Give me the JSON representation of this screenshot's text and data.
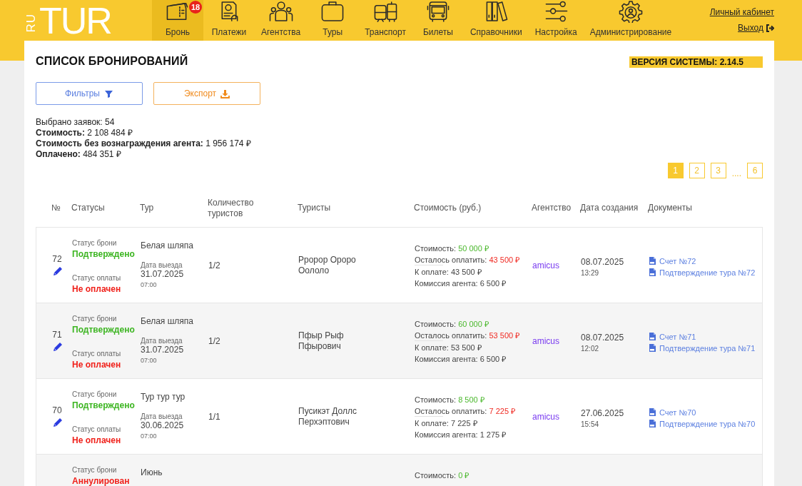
{
  "header": {
    "logo": {
      "prefix": "RU",
      "name": "TUR"
    },
    "nav": [
      {
        "label": "Бронь",
        "selected": true,
        "badge": "18"
      },
      {
        "label": "Платежи",
        "selected": false
      },
      {
        "label": "Агентства",
        "selected": false
      },
      {
        "label": "Туры",
        "selected": false
      },
      {
        "label": "Транспорт",
        "selected": false
      },
      {
        "label": "Билеты",
        "selected": false
      },
      {
        "label": "Справочники",
        "selected": false
      },
      {
        "label": "Настройка",
        "selected": false
      },
      {
        "label": "Администрирование",
        "selected": false
      }
    ],
    "account_links": [
      {
        "label": "Личный кабинет",
        "kind": "profile"
      },
      {
        "label": "Выход",
        "kind": "logout"
      }
    ]
  },
  "page": {
    "title": "СПИСОК БРОНИРОВАНИЙ",
    "version": "ВЕРСИЯ СИСТЕМЫ: 2.14.5",
    "buttons": [
      {
        "label": "Фильтры",
        "kind": "filter"
      },
      {
        "label": "Экспорт",
        "kind": "export"
      }
    ],
    "summary": [
      "Выбрано заявок: 54",
      "**Стоимость:** 2 108 484 ₽",
      "**Стоимость без вознаграждения агента:** 1 956 174 ₽",
      "**Оплачено:** 484 351 ₽"
    ],
    "pagination": [
      {
        "label": "1",
        "kind": "page",
        "selected": true
      },
      {
        "label": "2",
        "kind": "page",
        "selected": false
      },
      {
        "label": "3",
        "kind": "page",
        "selected": false
      },
      {
        "label": "....",
        "kind": "gap"
      },
      {
        "label": "6",
        "kind": "page",
        "selected": false
      }
    ]
  },
  "table": {
    "columns": [
      "№",
      "Статусы",
      "Тур",
      "Количество туристов",
      "Туристы",
      "Стоимость (руб.)",
      "Агентство",
      "Дата создания",
      "Документы"
    ],
    "rows": [
      {
        "number": "72",
        "statuses": [
          {
            "label": "Статус брони",
            "value": "Подтверждено",
            "kind": "ok"
          },
          {
            "label": "Статус оплаты",
            "value": "Не оплачен",
            "kind": "bad"
          }
        ],
        "tour": {
          "name": "Белая шляпа",
          "departure_label": "Дата выезда",
          "date": "31.07.2025",
          "time": "07:00"
        },
        "tourists_count": "1/2",
        "tourists": "Рророр Ороро Оололо",
        "cost": [
          {
            "label": "Стоимость:",
            "value": "50 000 ₽",
            "kind": "total"
          },
          {
            "label": "Осталось оплатить:",
            "value": "43 500 ₽",
            "kind": "due"
          },
          {
            "label": "К оплате:",
            "value": "43 500 ₽",
            "kind": "plain"
          },
          {
            "label": "Комиссия агента:",
            "value": "6 500 ₽",
            "kind": "plain"
          }
        ],
        "agency": "amicus",
        "created": {
          "date": "08.07.2025",
          "time": "13:29"
        },
        "documents": [
          "Счет №72",
          "Подтверждение тура №72"
        ]
      },
      {
        "number": "71",
        "statuses": [
          {
            "label": "Статус брони",
            "value": "Подтверждено",
            "kind": "ok"
          },
          {
            "label": "Статус оплаты",
            "value": "Не оплачен",
            "kind": "bad"
          }
        ],
        "tour": {
          "name": "Белая шляпа",
          "departure_label": "Дата выезда",
          "date": "31.07.2025",
          "time": "07:00"
        },
        "tourists_count": "1/2",
        "tourists": "Пфыр Рыф Пфырович",
        "cost": [
          {
            "label": "Стоимость:",
            "value": "60 000 ₽",
            "kind": "total"
          },
          {
            "label": "Осталось оплатить:",
            "value": "53 500 ₽",
            "kind": "due"
          },
          {
            "label": "К оплате:",
            "value": "53 500 ₽",
            "kind": "plain"
          },
          {
            "label": "Комиссия агента:",
            "value": "6 500 ₽",
            "kind": "plain"
          }
        ],
        "agency": "amicus",
        "created": {
          "date": "08.07.2025",
          "time": "12:02"
        },
        "documents": [
          "Счет №71",
          "Подтверждение тура №71"
        ]
      },
      {
        "number": "70",
        "statuses": [
          {
            "label": "Статус брони",
            "value": "Подтверждено",
            "kind": "ok"
          },
          {
            "label": "Статус оплаты",
            "value": "Не оплачен",
            "kind": "bad"
          }
        ],
        "tour": {
          "name": "Тур тур тур",
          "departure_label": "Дата выезда",
          "date": "30.06.2025",
          "time": "07:00"
        },
        "tourists_count": "1/1",
        "tourists": "Пусикэт Доллс Перхэптович",
        "cost": [
          {
            "label": "Стоимость:",
            "value": "8 500 ₽",
            "kind": "total"
          },
          {
            "label": "Осталось оплатить:",
            "value": "7 225 ₽",
            "kind": "due"
          },
          {
            "label": "К оплате:",
            "value": "7 225 ₽",
            "kind": "plain"
          },
          {
            "label": "Комиссия агента:",
            "value": "1 275 ₽",
            "kind": "plain"
          }
        ],
        "agency": "amicus",
        "created": {
          "date": "27.06.2025",
          "time": "15:54"
        },
        "documents": [
          "Счет №70",
          "Подтверждение тура №70"
        ]
      },
      {
        "statuses": [
          {
            "label": "Статус брони",
            "value": "Аннулирован",
            "kind": "bad"
          }
        ],
        "tour": {
          "name": "Июнь"
        },
        "cost": [
          {
            "label": "Стоимость:",
            "value": "0 ₽",
            "kind": "total"
          }
        ]
      }
    ]
  }
}
